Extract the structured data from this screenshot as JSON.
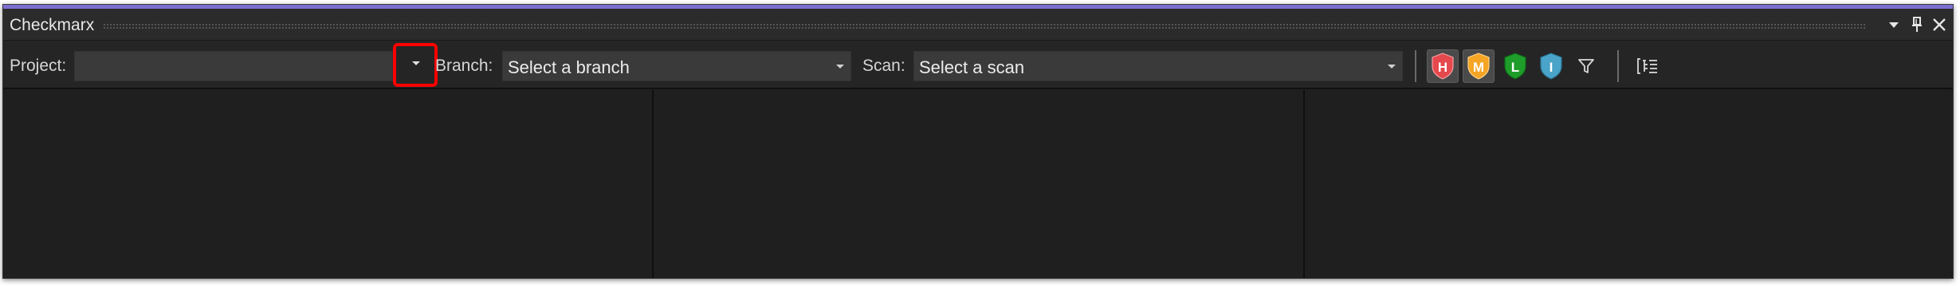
{
  "window": {
    "title": "Checkmarx"
  },
  "toolbar": {
    "project_label": "Project:",
    "project_value": "",
    "branch_label": "Branch:",
    "branch_value": "Select a branch",
    "scan_label": "Scan:",
    "scan_value": "Select a scan"
  },
  "severity_filters": [
    {
      "letter": "H",
      "name": "high",
      "color": "#e5484d",
      "active": true
    },
    {
      "letter": "M",
      "name": "medium",
      "color": "#f5a524",
      "active": true
    },
    {
      "letter": "L",
      "name": "low",
      "color": "#1f9d2a",
      "active": false
    },
    {
      "letter": "I",
      "name": "info",
      "color": "#4aa3c8",
      "active": false
    }
  ],
  "colors": {
    "accent": "#7c6fd0",
    "highlight": "#ff0000",
    "background": "#1f1f1f"
  },
  "icons": [
    "dropdown-menu-icon",
    "pin-icon",
    "close-icon",
    "filter-icon",
    "group-by-icon"
  ]
}
